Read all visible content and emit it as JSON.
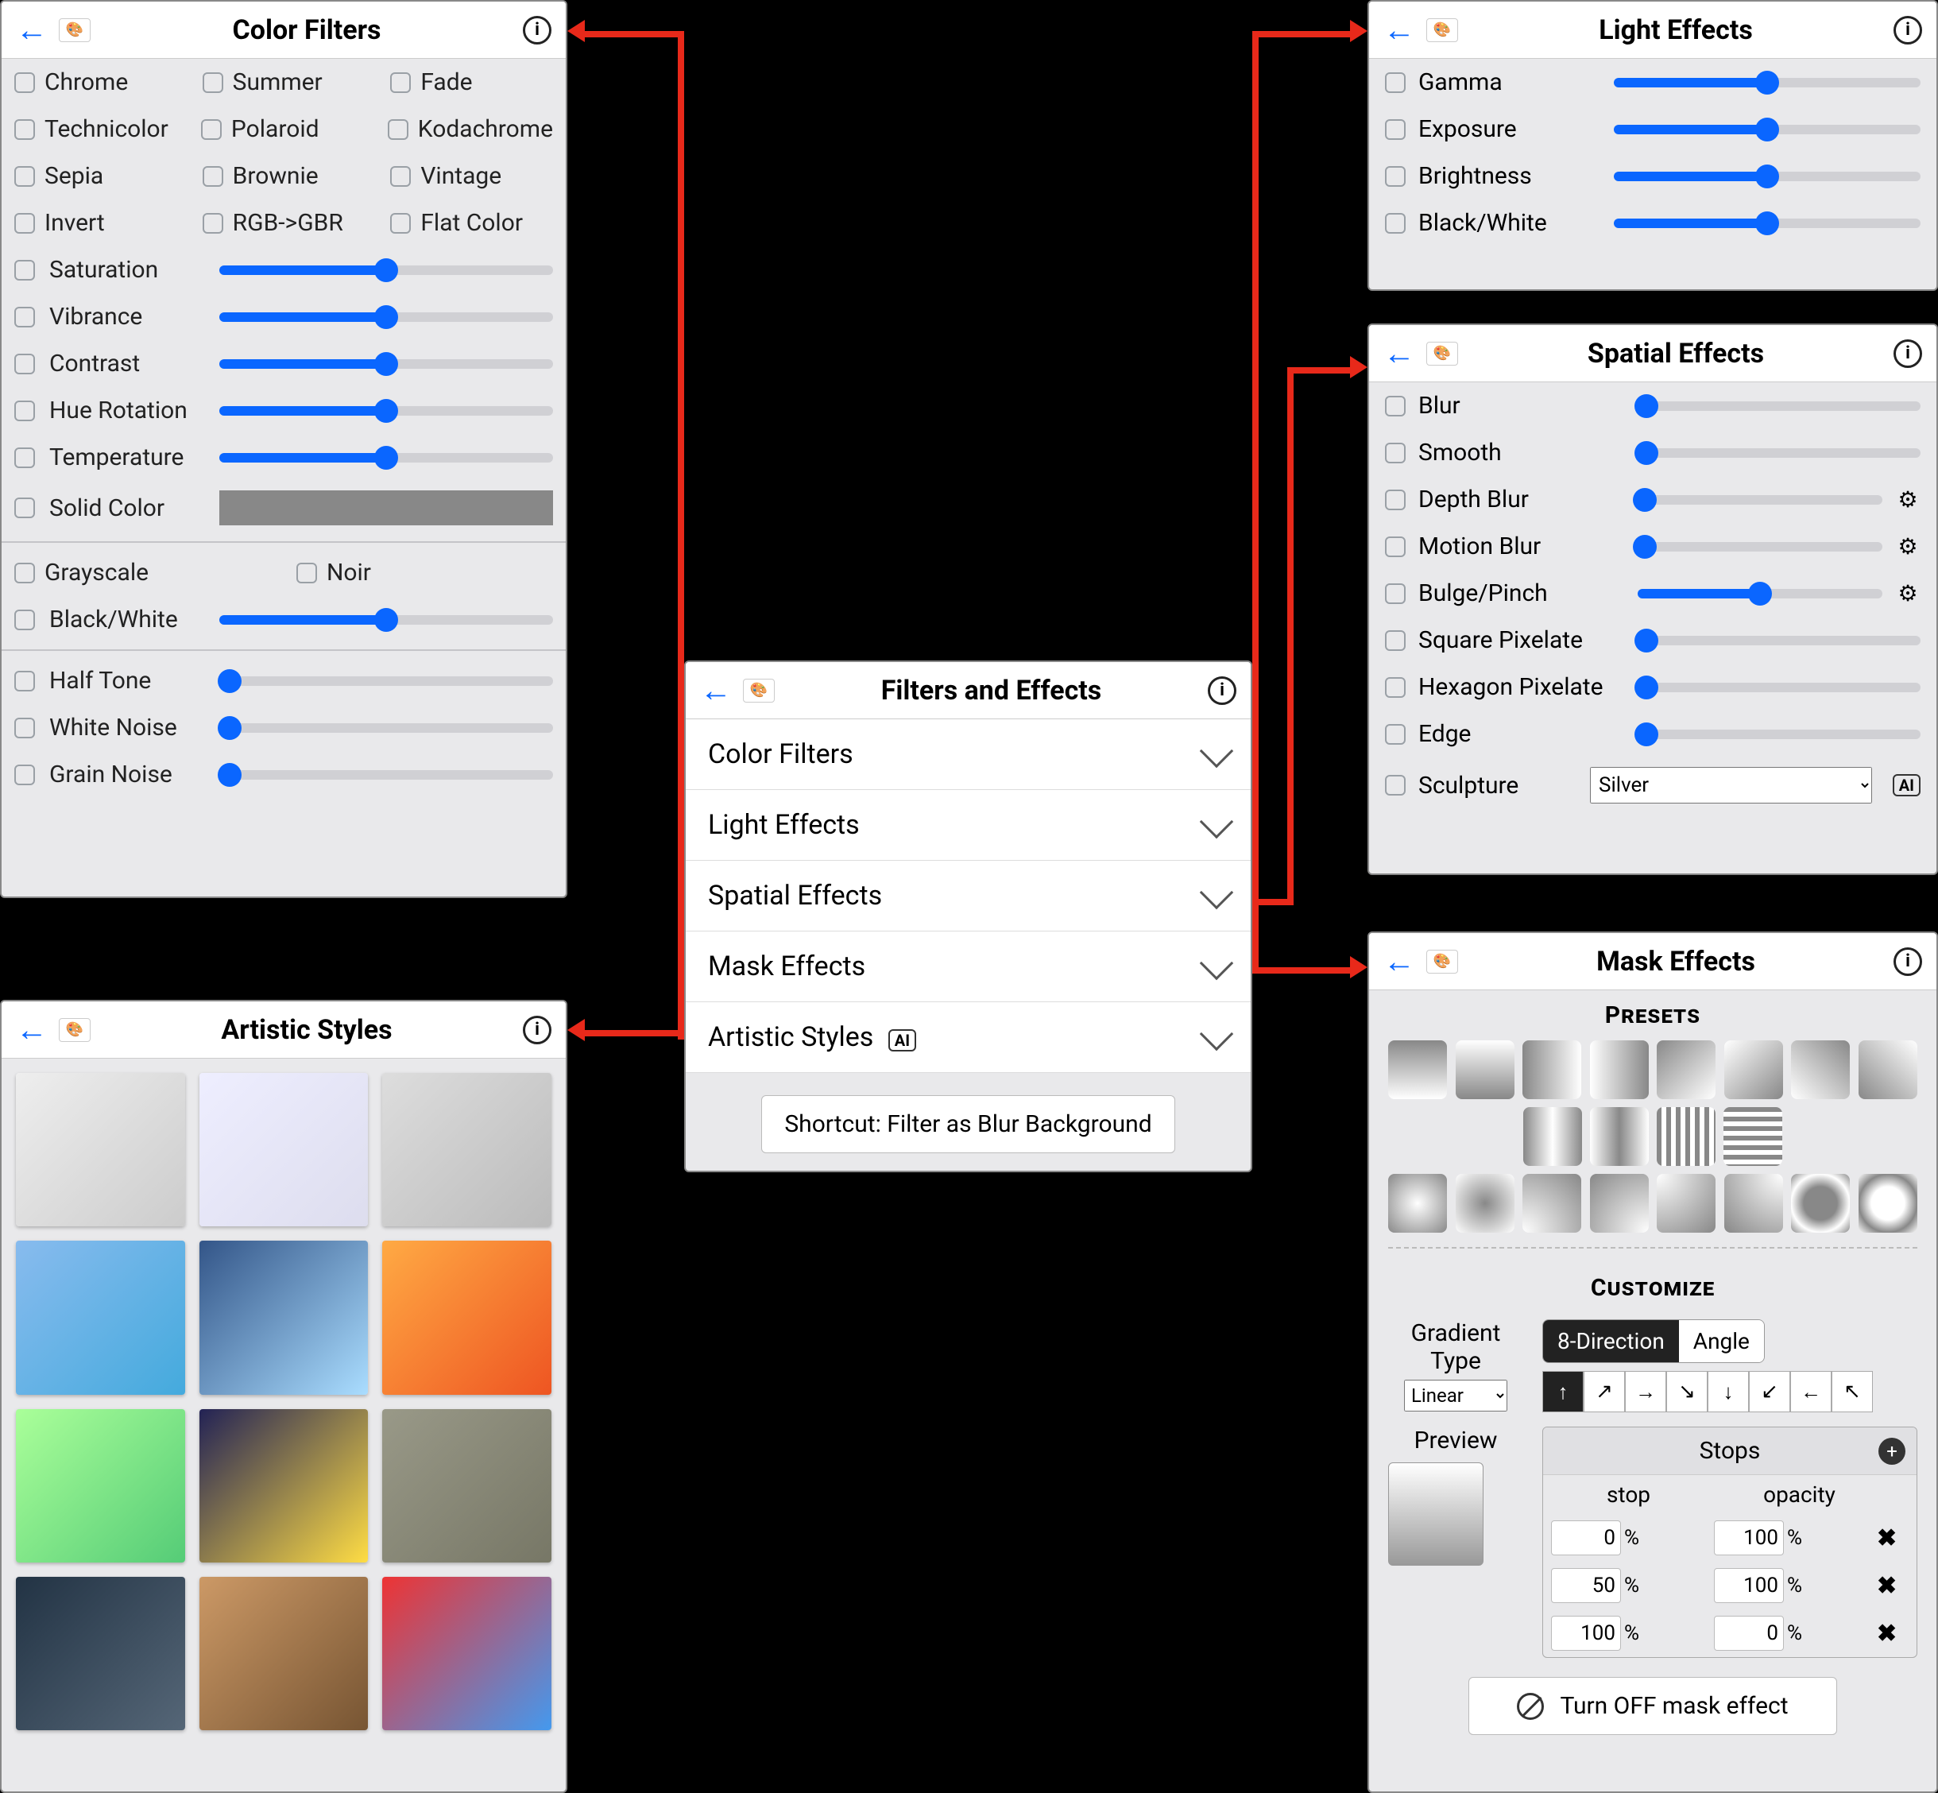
{
  "center": {
    "title": "Filters and Effects",
    "items": [
      {
        "label": "Color Filters",
        "ai": false
      },
      {
        "label": "Light Effects",
        "ai": false
      },
      {
        "label": "Spatial Effects",
        "ai": false
      },
      {
        "label": "Mask Effects",
        "ai": false
      },
      {
        "label": "Artistic Styles",
        "ai": true
      }
    ],
    "shortcut": "Shortcut: Filter as Blur Background"
  },
  "colorFilters": {
    "title": "Color Filters",
    "checks": [
      [
        "Chrome",
        "Summer",
        "Fade"
      ],
      [
        "Technicolor",
        "Polaroid",
        "Kodachrome"
      ],
      [
        "Sepia",
        "Brownie",
        "Vintage"
      ],
      [
        "Invert",
        "RGB->GBR",
        "Flat Color"
      ]
    ],
    "sliders": [
      "Saturation",
      "Vibrance",
      "Contrast",
      "Hue Rotation",
      "Temperature"
    ],
    "solid": "Solid Color",
    "gs": [
      "Grayscale",
      "Noir"
    ],
    "bw": "Black/White",
    "noise": [
      "Half Tone",
      "White Noise",
      "Grain Noise"
    ]
  },
  "lightEffects": {
    "title": "Light Effects",
    "sliders": [
      "Gamma",
      "Exposure",
      "Brightness",
      "Black/White"
    ]
  },
  "spatial": {
    "title": "Spatial Effects",
    "rows": [
      {
        "label": "Blur",
        "gear": false,
        "min": true
      },
      {
        "label": "Smooth",
        "gear": false,
        "min": true
      },
      {
        "label": "Depth Blur",
        "gear": true,
        "min": true
      },
      {
        "label": "Motion Blur",
        "gear": true,
        "min": true
      },
      {
        "label": "Bulge/Pinch",
        "gear": true,
        "min": false
      },
      {
        "label": "Square Pixelate",
        "gear": false,
        "min": true
      },
      {
        "label": "Hexagon Pixelate",
        "gear": false,
        "min": true
      },
      {
        "label": "Edge",
        "gear": false,
        "min": true
      }
    ],
    "sculpture": "Sculpture",
    "sculpture_value": "Silver"
  },
  "mask": {
    "title": "Mask Effects",
    "presets_label": "Presets",
    "customize_label": "Customize",
    "gradient_type_label": "Gradient Type",
    "gradient_type_value": "Linear",
    "seg": [
      "8-Direction",
      "Angle"
    ],
    "seg_active": 0,
    "directions": [
      "↑",
      "↗",
      "→",
      "↘",
      "↓",
      "↙",
      "←",
      "↖"
    ],
    "dir_active": 0,
    "preview_label": "Preview",
    "stops_label": "Stops",
    "stops_cols": [
      "stop",
      "opacity"
    ],
    "stops": [
      {
        "stop": 0,
        "opacity": 100
      },
      {
        "stop": 50,
        "opacity": 100
      },
      {
        "stop": 100,
        "opacity": 0
      }
    ],
    "pct": "%",
    "turn_off": "Turn OFF mask effect"
  },
  "artistic": {
    "title": "Artistic Styles",
    "tiles": 12
  }
}
